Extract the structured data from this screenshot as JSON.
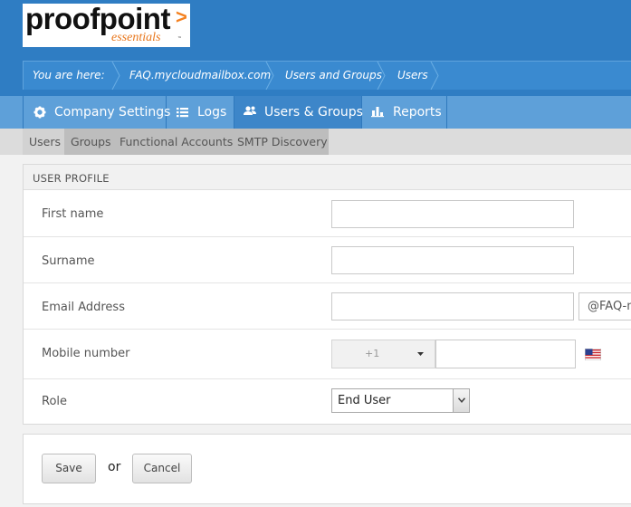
{
  "logo": {
    "main": "proofpoint",
    "chevron": ">",
    "sub": "essentials",
    "tm": "™"
  },
  "breadcrumb": {
    "prefix": "You are here:",
    "items": [
      "FAQ.mycloudmailbox.com",
      "Users and Groups",
      "Users"
    ]
  },
  "mainnav": {
    "tabs": [
      {
        "label": "Company Settings",
        "icon": "gear-icon"
      },
      {
        "label": "Logs",
        "icon": "list-icon"
      },
      {
        "label": "Users & Groups",
        "icon": "users-icon",
        "active": true
      },
      {
        "label": "Reports",
        "icon": "bar-chart-icon"
      }
    ]
  },
  "subnav": {
    "tabs": [
      {
        "label": "Users",
        "active": true
      },
      {
        "label": "Groups"
      },
      {
        "label": "Functional Accounts"
      },
      {
        "label": "SMTP Discovery"
      }
    ]
  },
  "profile": {
    "heading": "USER PROFILE",
    "first_name_label": "First name",
    "first_name_value": "",
    "surname_label": "Surname",
    "surname_value": "",
    "email_label": "Email Address",
    "email_value": "",
    "email_domain": "@FAQ-m",
    "mobile_label": "Mobile number",
    "mobile_code": "+1",
    "mobile_value": "",
    "flag_icon": "us-flag-icon",
    "role_label": "Role",
    "role_value": "End User"
  },
  "actions": {
    "save_label": "Save",
    "or_text": "or",
    "cancel_label": "Cancel"
  },
  "colors": {
    "header_blue": "#2f7dc3",
    "nav_blue": "#5ea0d9",
    "accent_orange": "#f48120"
  }
}
